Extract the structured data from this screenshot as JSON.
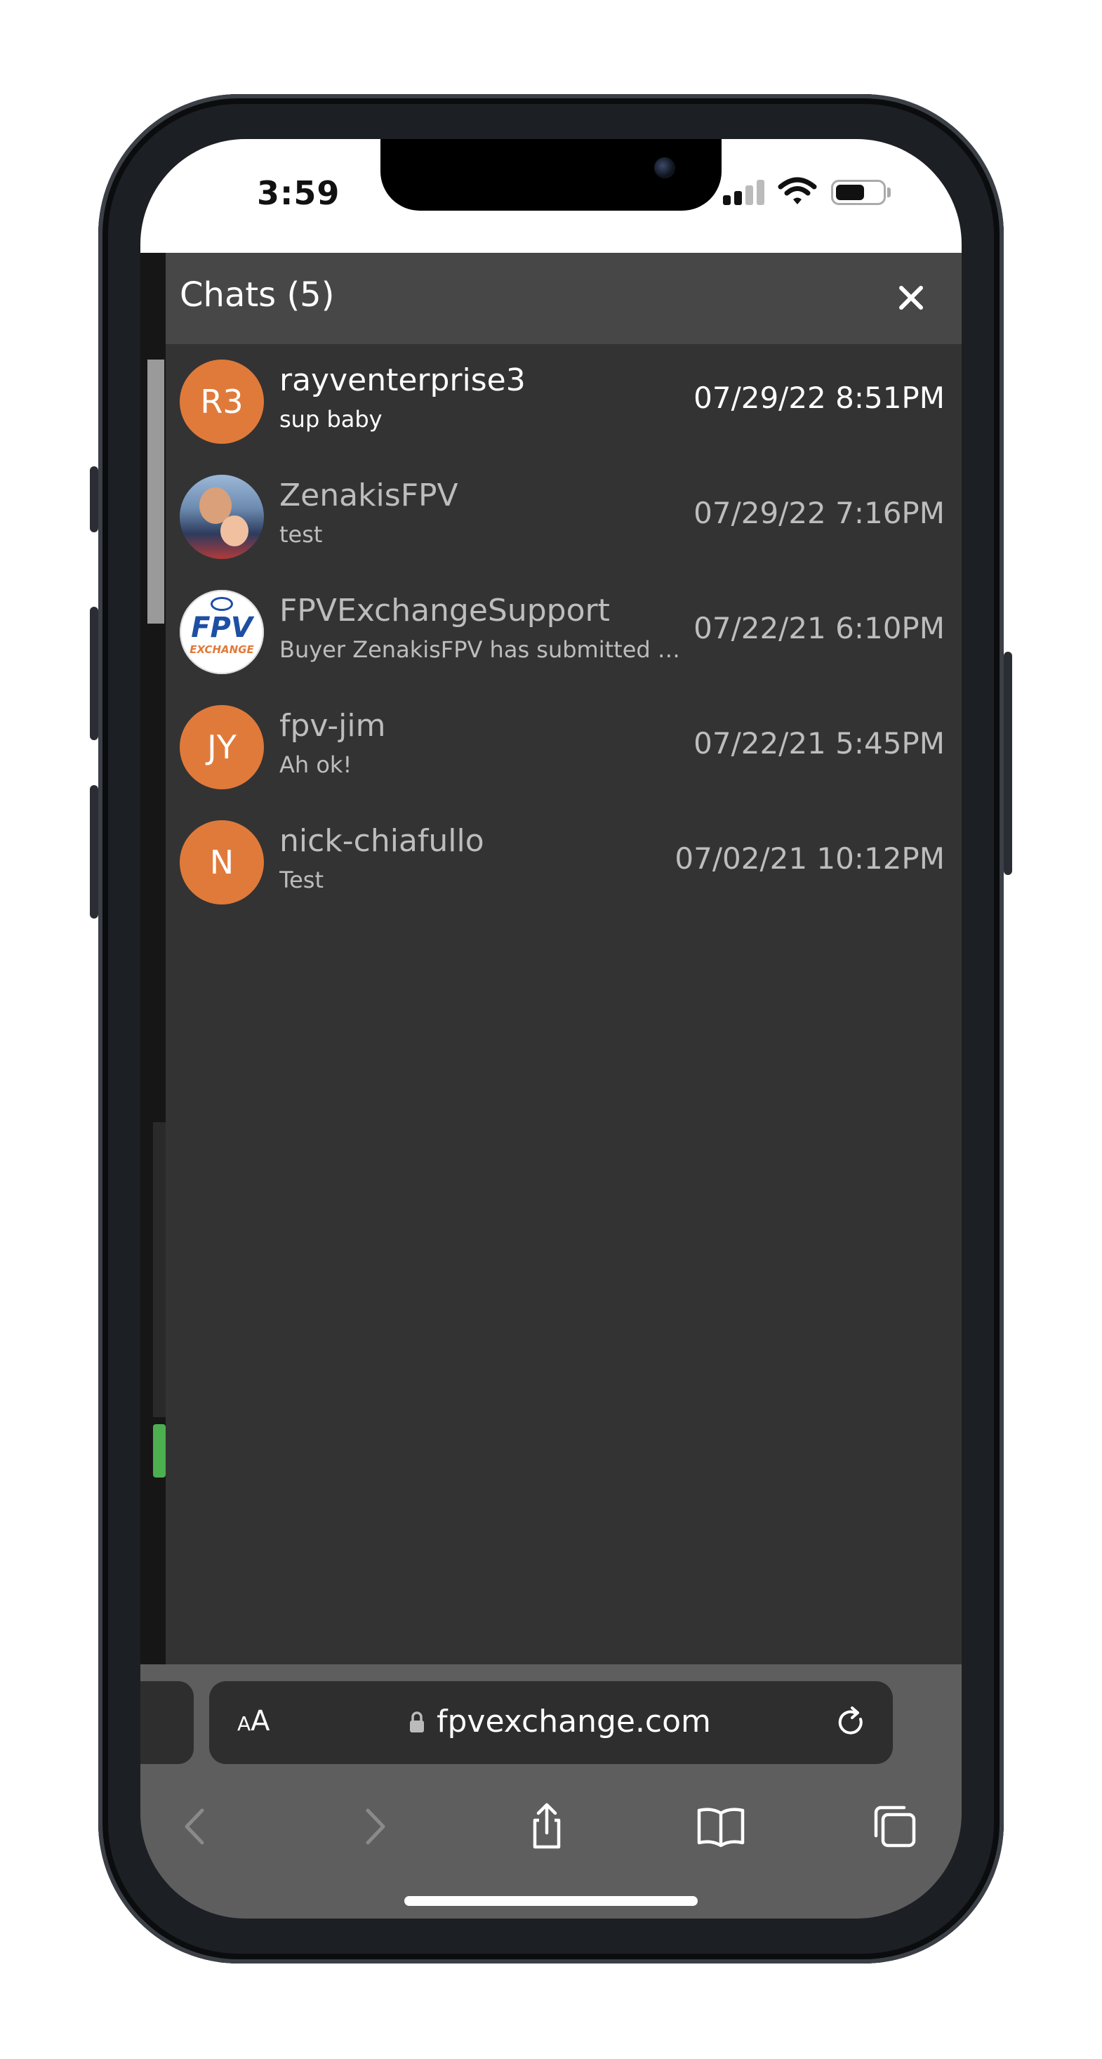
{
  "status_bar": {
    "time": "3:59"
  },
  "chat_panel": {
    "title": "Chats (5)",
    "close_icon": "close-icon",
    "chats": [
      {
        "avatar_text": "R3",
        "avatar_type": "initials",
        "username": "rayventerprise3",
        "last_message": "sup baby",
        "timestamp": "07/29/22 8:51PM",
        "unread": true
      },
      {
        "avatar_text": "",
        "avatar_type": "photo",
        "username": "ZenakisFPV",
        "last_message": "test",
        "timestamp": "07/29/22 7:16PM",
        "unread": false
      },
      {
        "avatar_text": "",
        "avatar_type": "logo",
        "username": "FPVExchangeSupport",
        "last_message": "Buyer ZenakisFPV has submitted a...",
        "timestamp": "07/22/21 6:10PM",
        "unread": false
      },
      {
        "avatar_text": "JY",
        "avatar_type": "initials",
        "username": "fpv-jim",
        "last_message": "Ah ok!",
        "timestamp": "07/22/21 5:45PM",
        "unread": false
      },
      {
        "avatar_text": "N",
        "avatar_type": "initials",
        "username": "nick-chiafullo",
        "last_message": "Test",
        "timestamp": "07/02/21 10:12PM",
        "unread": false
      }
    ],
    "logo_text": {
      "main": "FPV",
      "sub": "EXCHANGE"
    }
  },
  "safari": {
    "text_size_label": {
      "small": "A",
      "large": "A"
    },
    "url": "fpvexchange.com",
    "icons": [
      "lock-icon",
      "reload-icon",
      "back-icon",
      "forward-icon",
      "share-icon",
      "bookmarks-icon",
      "tabs-icon"
    ]
  },
  "colors": {
    "avatar_orange": "#e07a3a",
    "panel_bg": "#333333",
    "header_bg": "#474747",
    "toolbar_bg": "#5e5e5e"
  }
}
